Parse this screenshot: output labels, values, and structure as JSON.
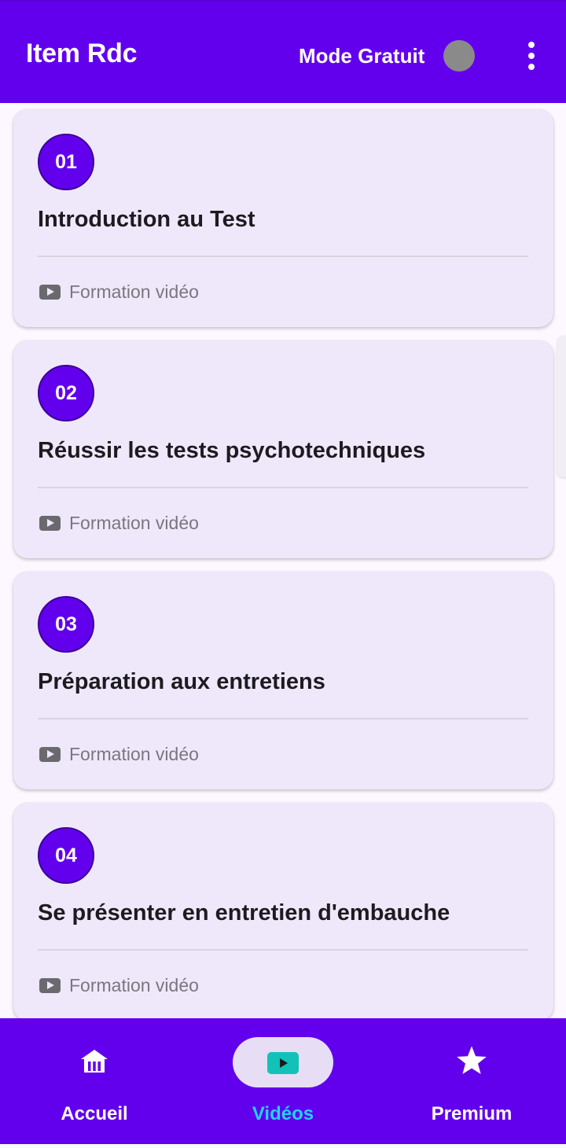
{
  "header": {
    "app_title": "Item Rdc",
    "mode_label": "Mode Gratuit",
    "toggle_color": "#8a8a8a",
    "background_color": "#6200ee"
  },
  "videos": [
    {
      "number": "01",
      "title": "Introduction au Test",
      "type_label": "Formation vidéo",
      "icon": "play-icon"
    },
    {
      "number": "02",
      "title": "Réussir les tests psychotechniques",
      "type_label": "Formation vidéo",
      "icon": "play-icon"
    },
    {
      "number": "03",
      "title": "Préparation aux entretiens",
      "type_label": "Formation vidéo",
      "icon": "play-icon"
    },
    {
      "number": "04",
      "title": "Se présenter en entretien d'embauche",
      "type_label": "Formation vidéo",
      "icon": "play-icon"
    }
  ],
  "bottom_nav": {
    "items": [
      {
        "label": "Accueil",
        "icon": "home-icon",
        "active": false
      },
      {
        "label": "Vidéos",
        "icon": "video-icon",
        "active": true
      },
      {
        "label": "Premium",
        "icon": "star-icon",
        "active": false
      }
    ],
    "active_color": "#22d3f5"
  }
}
